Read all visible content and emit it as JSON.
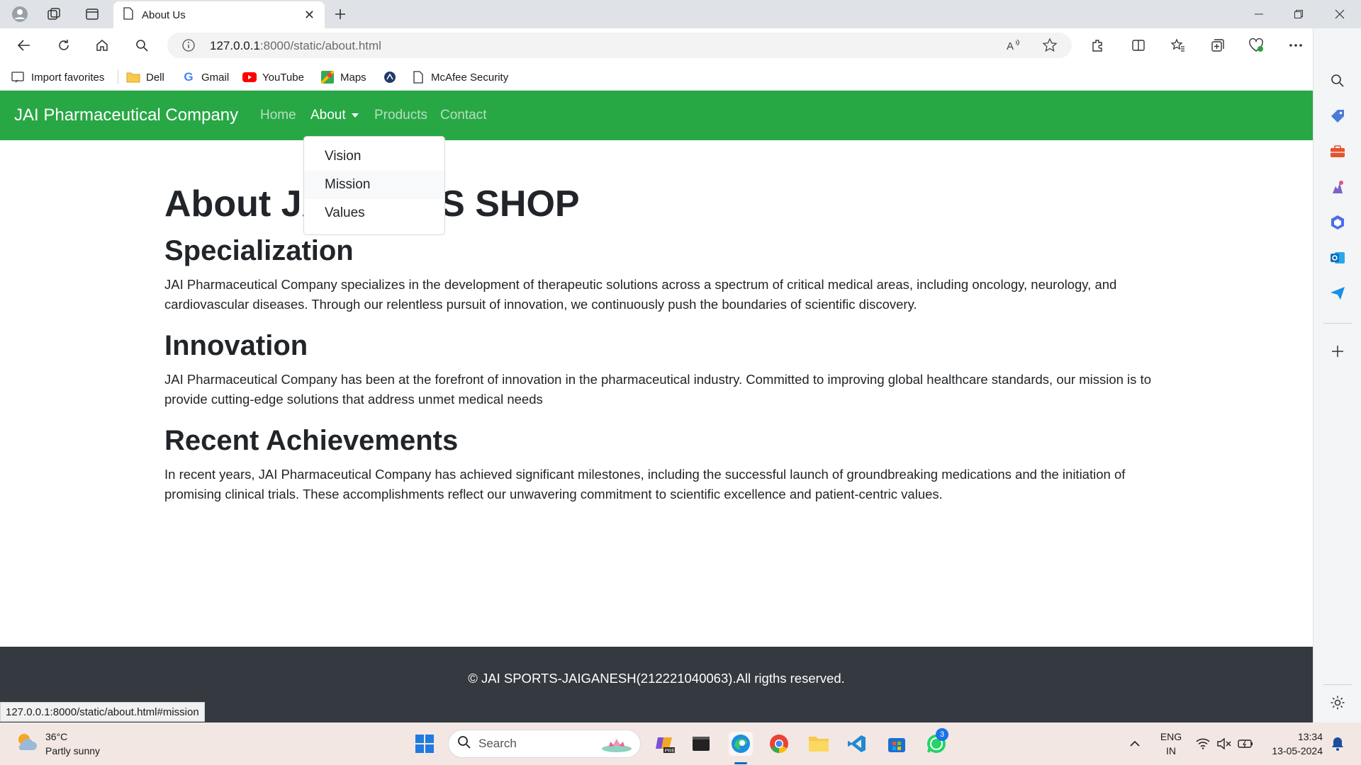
{
  "browser": {
    "tab": {
      "title": "About Us"
    },
    "address": {
      "host": "127.0.0.1",
      "rest": ":8000/static/about.html"
    },
    "bookmarks": [
      "Import favorites",
      "Dell",
      "Gmail",
      "YouTube",
      "Maps",
      "McAfee Security"
    ],
    "status_url": "127.0.0.1:8000/static/about.html#mission"
  },
  "site": {
    "brand": "JAI Pharmaceutical Company",
    "nav": {
      "home": "Home",
      "about": "About",
      "products": "Products",
      "contact": "Contact"
    },
    "dropdown": [
      "Vision",
      "Mission",
      "Values"
    ],
    "h1_visible_left": "About JA",
    "h1_visible_right": "S SHOP",
    "sections": [
      {
        "heading": "Specialization",
        "text": "JAI Pharmaceutical Company specializes in the development of therapeutic solutions across a spectrum of critical medical areas, including oncology, neurology, and cardiovascular diseases. Through our relentless pursuit of innovation, we continuously push the boundaries of scientific discovery."
      },
      {
        "heading": "Innovation",
        "text": "JAI Pharmaceutical Company has been at the forefront of innovation in the pharmaceutical industry. Committed to improving global healthcare standards, our mission is to provide cutting-edge solutions that address unmet medical needs"
      },
      {
        "heading": "Recent Achievements",
        "text": "In recent years, JAI Pharmaceutical Company has achieved significant milestones, including the successful launch of groundbreaking medications and the initiation of promising clinical trials. These accomplishments reflect our unwavering commitment to scientific excellence and patient-centric values."
      }
    ],
    "footer": "© JAI SPORTS-JAIGANESH(212221040063).All rigths reserved."
  },
  "taskbar": {
    "weather": {
      "temp": "36°C",
      "desc": "Partly sunny"
    },
    "search_label": "Search",
    "whatsapp_badge": "3",
    "lang": {
      "line1": "ENG",
      "line2": "IN"
    },
    "clock": {
      "time": "13:34",
      "date": "13-05-2024"
    }
  },
  "colors": {
    "navbar": "#28a745",
    "footer": "#343a40",
    "taskbar": "#f2e7e3"
  }
}
